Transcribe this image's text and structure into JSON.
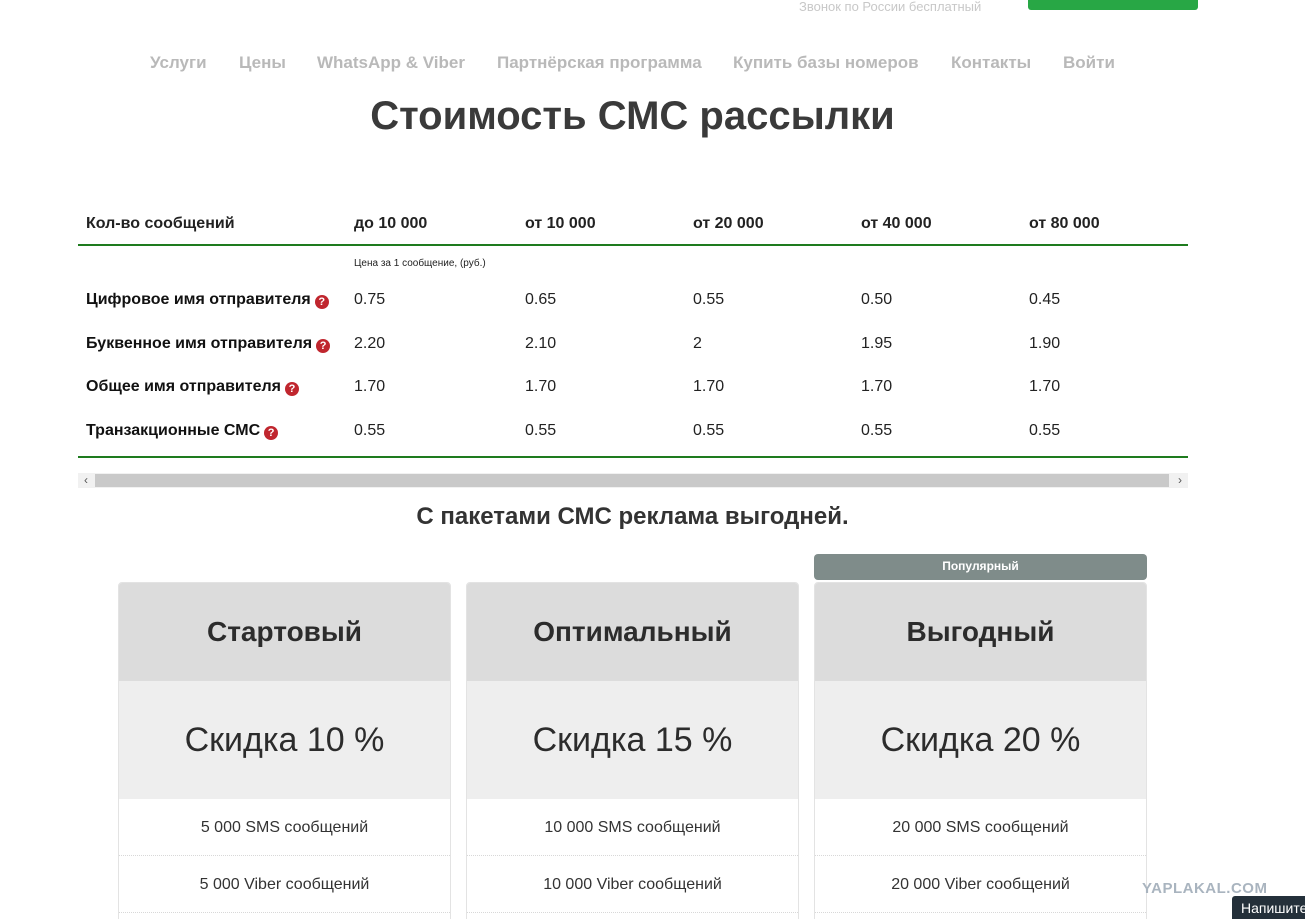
{
  "header": {
    "phone_note": "Звонок по России бесплатный"
  },
  "nav": {
    "items": [
      "Услуги",
      "Цены",
      "WhatsApp & Viber",
      "Партнёрская программа",
      "Купить базы номеров",
      "Контакты",
      "Войти"
    ]
  },
  "page": {
    "title": "Стоимость СМС рассылки",
    "subtitle": "С пакетами СМС реклама выгодней."
  },
  "price_table": {
    "headers": [
      "Кол-во сообщений",
      "до 10 000",
      "от 10 000",
      "от 20 000",
      "от 40 000",
      "от 80 000"
    ],
    "note": "Цена за 1 сообщение, (руб.)",
    "rows": [
      {
        "label": "Цифровое имя отправителя",
        "values": [
          "0.75",
          "0.65",
          "0.55",
          "0.50",
          "0.45"
        ]
      },
      {
        "label": "Буквенное имя отправителя",
        "values": [
          "2.20",
          "2.10",
          "2",
          "1.95",
          "1.90"
        ]
      },
      {
        "label": "Общее имя отправителя",
        "values": [
          "1.70",
          "1.70",
          "1.70",
          "1.70",
          "1.70"
        ]
      },
      {
        "label": "Транзакционные СМС",
        "values": [
          "0.55",
          "0.55",
          "0.55",
          "0.55",
          "0.55"
        ]
      }
    ],
    "help_icon": "?"
  },
  "scrollbar": {
    "left_arrow": "‹",
    "right_arrow": "›"
  },
  "plans": {
    "popular_label": "Популярный",
    "items": [
      {
        "name": "Стартовый",
        "discount": "Скидка 10 %",
        "features": [
          "5 000 SMS сообщений",
          "5 000 Viber сообщений"
        ]
      },
      {
        "name": "Оптимальный",
        "discount": "Скидка 15 %",
        "features": [
          "10 000 SMS сообщений",
          "10 000 Viber сообщений"
        ]
      },
      {
        "name": "Выгодный",
        "discount": "Скидка 20 %",
        "features": [
          "20 000 SMS сообщений",
          "20 000 Viber сообщений"
        ]
      }
    ]
  },
  "overlay": {
    "watermark": "YAPLAKAL.COM",
    "chat_label": "Напишите"
  }
}
